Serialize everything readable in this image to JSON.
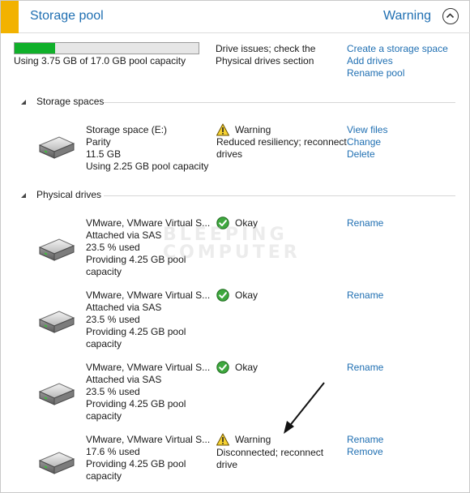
{
  "header": {
    "title": "Storage pool",
    "status": "Warning"
  },
  "pool": {
    "capacity_text": "Using 3.75 GB of 17.0 GB pool capacity",
    "capacity_used_fraction": 0.22,
    "issue_line1": "Drive issues; check the",
    "issue_line2": "Physical drives section",
    "actions": [
      "Create a storage space",
      "Add drives",
      "Rename pool"
    ]
  },
  "storage_spaces": {
    "section_label": "Storage spaces",
    "items": [
      {
        "name": "Storage space (E:)",
        "type": "Parity",
        "size": "11.5 GB",
        "usage": "Using 2.25 GB pool capacity",
        "status_icon": "warning-icon",
        "status": "Warning",
        "detail_line1": "Reduced resiliency; reconnect",
        "detail_line2": "drives",
        "actions": [
          "View files",
          "Change",
          "Delete"
        ]
      }
    ]
  },
  "physical_drives": {
    "section_label": "Physical drives",
    "items": [
      {
        "name": "VMware, VMware Virtual S...",
        "attachment": "Attached via SAS",
        "used": "23.5 % used",
        "provide_line1": "Providing 4.25 GB pool",
        "provide_line2": "capacity",
        "status_icon": "ok-check-icon",
        "status": "Okay",
        "actions": [
          "Rename"
        ]
      },
      {
        "name": "VMware, VMware Virtual S...",
        "attachment": "Attached via SAS",
        "used": "23.5 % used",
        "provide_line1": "Providing 4.25 GB pool",
        "provide_line2": "capacity",
        "status_icon": "ok-check-icon",
        "status": "Okay",
        "actions": [
          "Rename"
        ]
      },
      {
        "name": "VMware, VMware Virtual S...",
        "attachment": "Attached via SAS",
        "used": "23.5 % used",
        "provide_line1": "Providing 4.25 GB pool",
        "provide_line2": "capacity",
        "status_icon": "ok-check-icon",
        "status": "Okay",
        "actions": [
          "Rename"
        ]
      },
      {
        "name": "VMware, VMware Virtual S...",
        "used": "17.6 % used",
        "provide_line1": "Providing 4.25 GB pool",
        "provide_line2": "capacity",
        "status_icon": "warning-icon",
        "status": "Warning",
        "detail_line1": "Disconnected; reconnect",
        "detail_line2": "drive",
        "actions": [
          "Rename",
          "Remove"
        ]
      }
    ]
  },
  "watermark": {
    "line1": "BLEEPING",
    "line2": "COMPUTER"
  },
  "colors": {
    "accent": "#f2b200",
    "link": "#1f6fb2",
    "progress": "#10b02a"
  }
}
